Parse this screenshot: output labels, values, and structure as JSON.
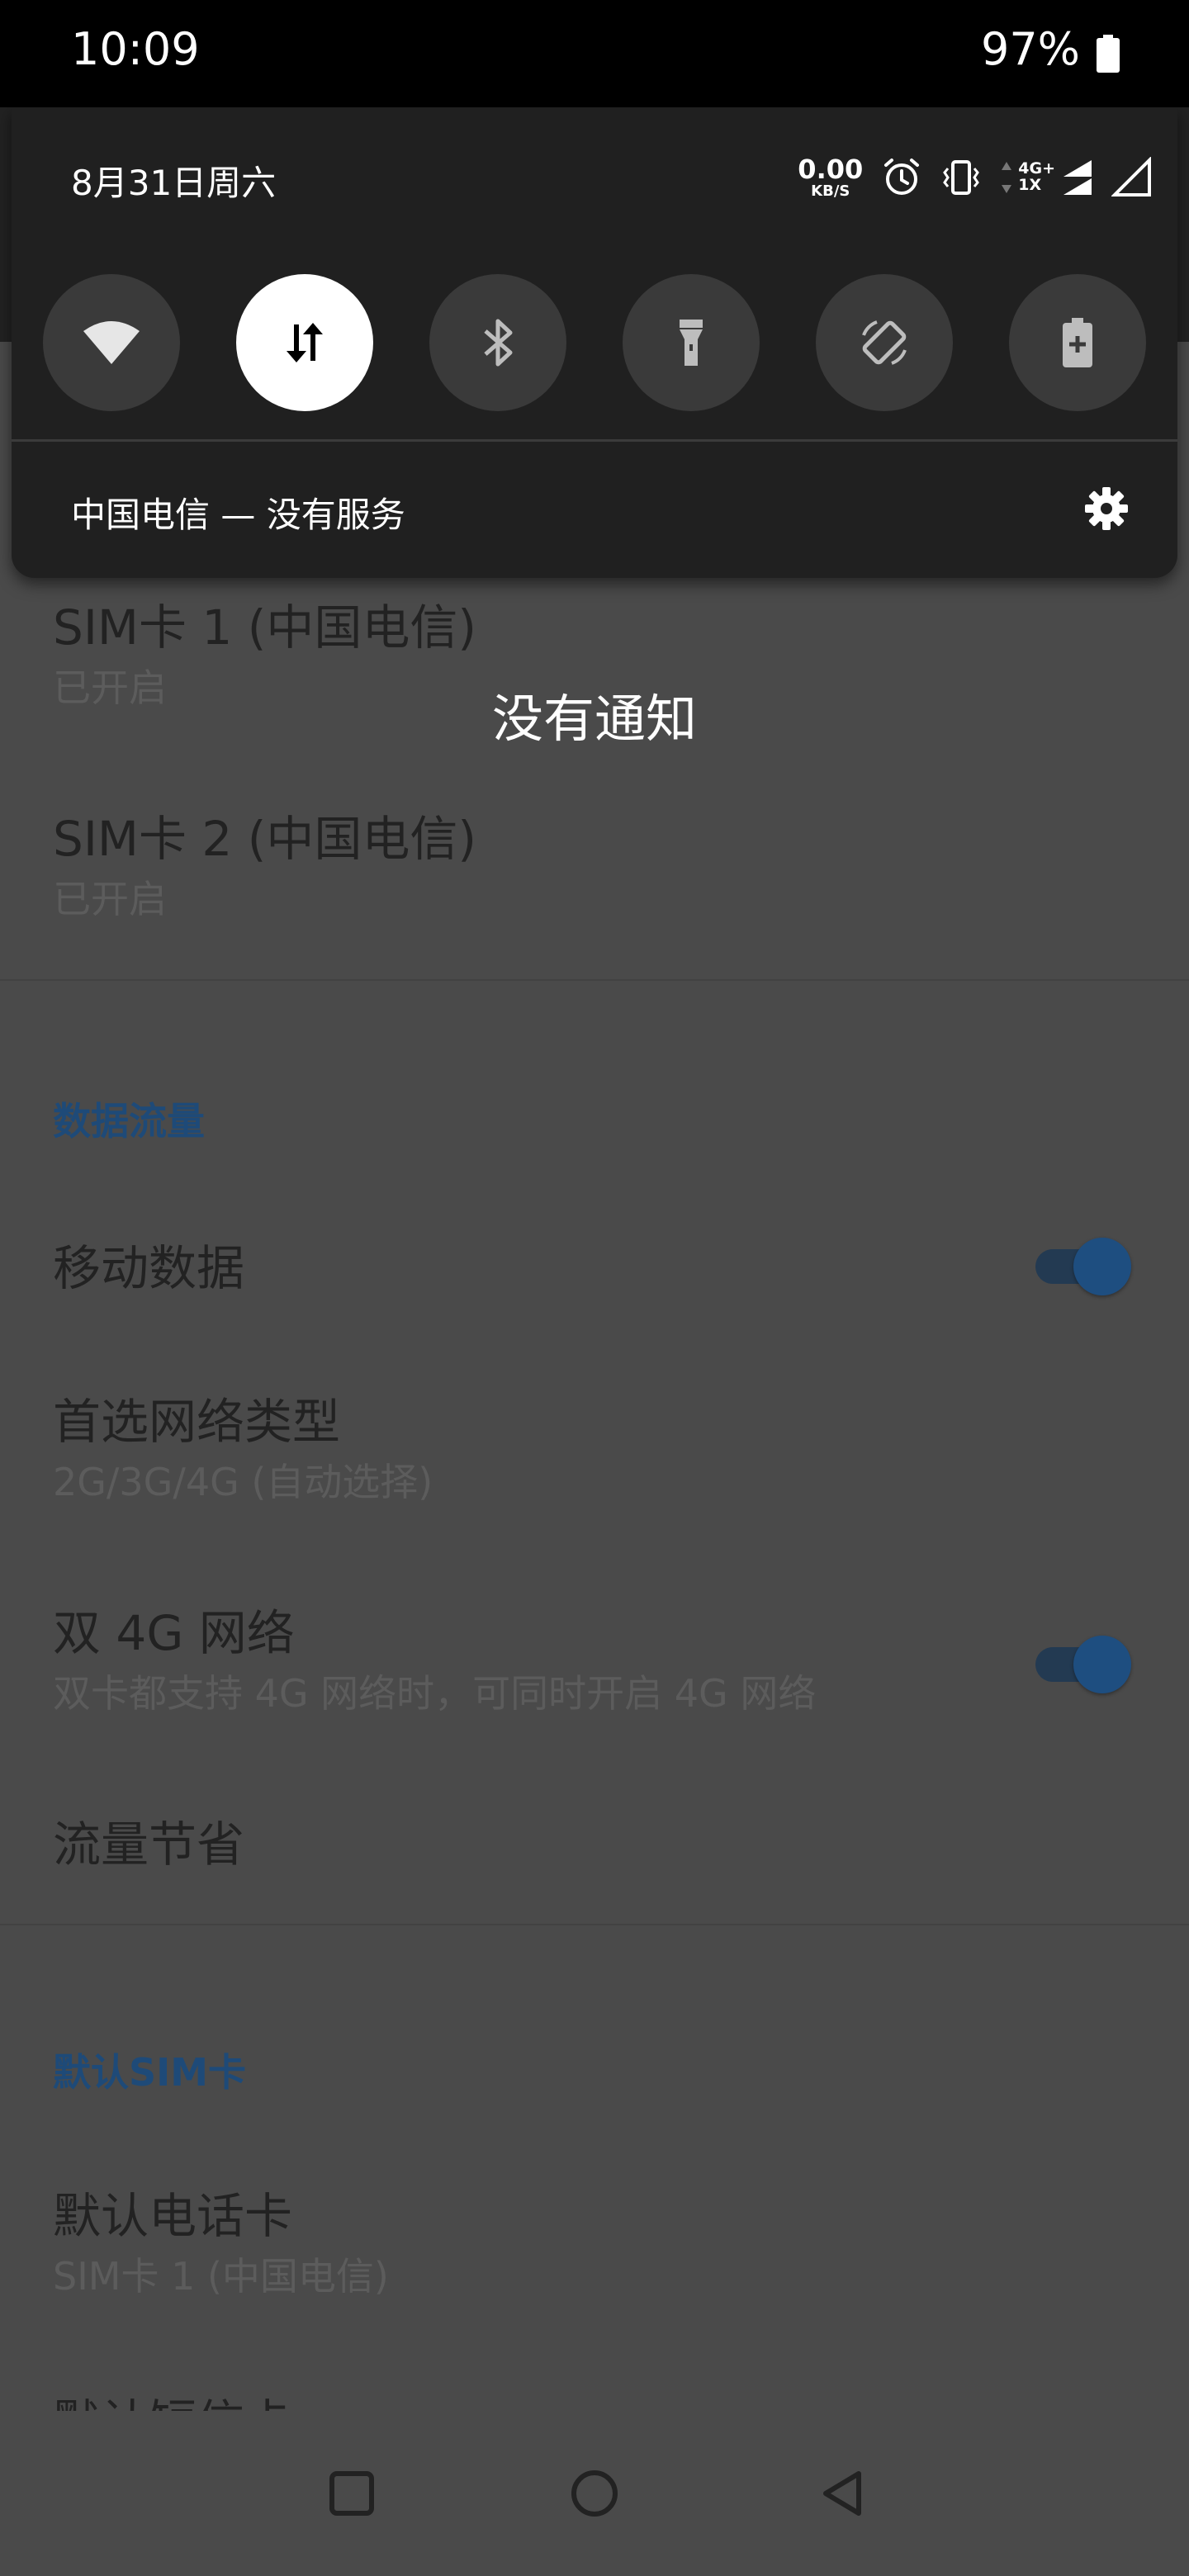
{
  "status_bar": {
    "time": "10:09",
    "battery_percent": "97%"
  },
  "shade": {
    "date": "8月31日周六",
    "net_speed_value": "0.00",
    "net_speed_unit": "KB/S",
    "network_badge_top": "4G+",
    "network_badge_bottom": "1X",
    "status_icons": [
      "alarm-icon",
      "vibrate-icon",
      "data-arrows-icon",
      "signal-icon",
      "signal-empty-icon"
    ],
    "quick_settings": [
      {
        "name": "wifi",
        "icon": "wifi-icon",
        "active": false
      },
      {
        "name": "mobile-data",
        "icon": "data-transfer-icon",
        "active": true
      },
      {
        "name": "bluetooth",
        "icon": "bluetooth-icon",
        "active": false
      },
      {
        "name": "flashlight",
        "icon": "flashlight-icon",
        "active": false
      },
      {
        "name": "auto-rotate",
        "icon": "rotate-icon",
        "active": false
      },
      {
        "name": "battery-saver",
        "icon": "battery-saver-icon",
        "active": false
      }
    ],
    "carrier_text": "中国电信 — 没有服务",
    "settings_icon": "gear-icon"
  },
  "no_notifications": "没有通知",
  "settings": {
    "sim1": {
      "title": "SIM卡 1 (中国电信)",
      "subtitle": "已开启"
    },
    "sim2": {
      "title": "SIM卡 2 (中国电信)",
      "subtitle": "已开启"
    },
    "section_data": "数据流量",
    "mobile_data": {
      "title": "移动数据",
      "enabled": true
    },
    "network_type": {
      "title": "首选网络类型",
      "subtitle": "2G/3G/4G (自动选择)"
    },
    "dual_4g": {
      "title": "双 4G 网络",
      "subtitle": "双卡都支持 4G 网络时，可同时开启 4G 网络",
      "enabled": true
    },
    "data_saver": {
      "title": "流量节省"
    },
    "section_default_sim": "默认SIM卡",
    "default_call": {
      "title": "默认电话卡",
      "subtitle": "SIM卡 1 (中国电信)"
    },
    "default_sms": {
      "title": "默认短信卡"
    }
  },
  "nav_bar": {
    "recents_icon": "square-icon",
    "home_icon": "circle-icon",
    "back_icon": "triangle-back-icon"
  },
  "colors": {
    "accent": "#1e4a78",
    "shade_background": "#202020",
    "tile_inactive": "#3a3a3a",
    "tile_active": "#ffffff"
  }
}
